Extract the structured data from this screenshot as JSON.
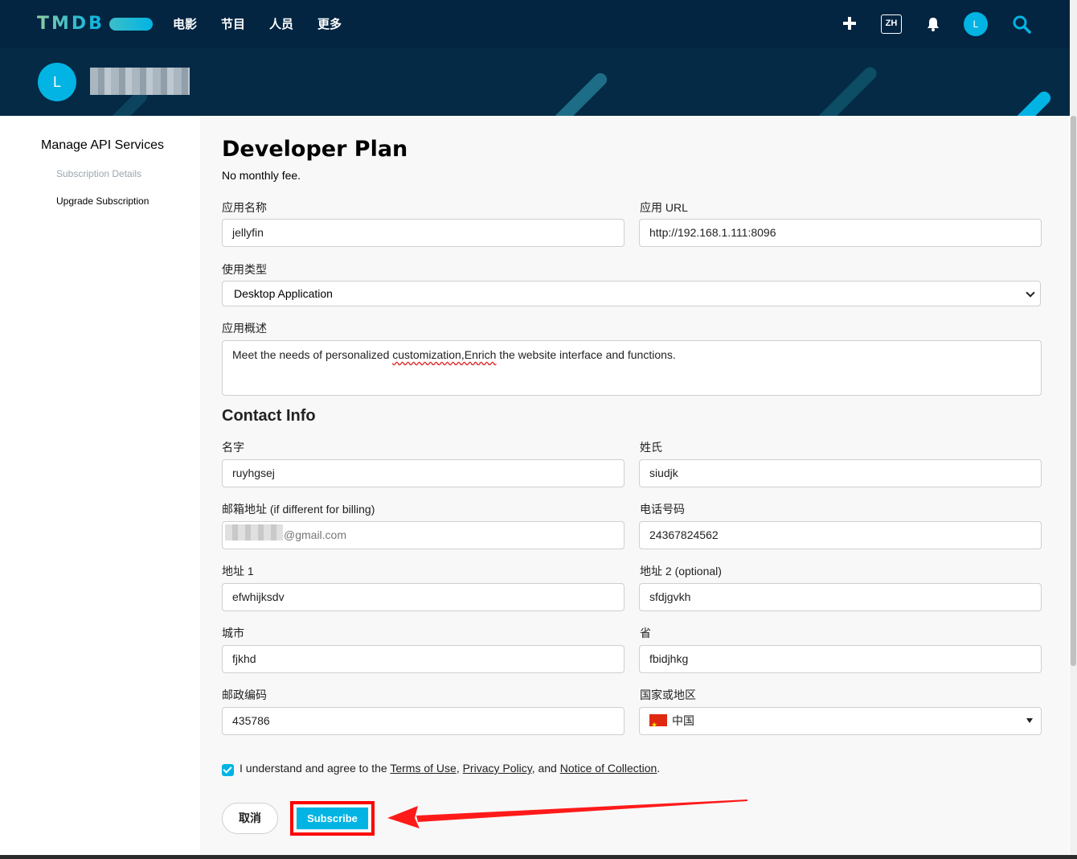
{
  "nav": {
    "logo": "TMDB",
    "links": [
      "电影",
      "节目",
      "人员",
      "更多"
    ],
    "lang": "ZH",
    "avatar_letter": "L"
  },
  "profile": {
    "avatar_letter": "L"
  },
  "sidebar": {
    "title": "Manage API Services",
    "items": [
      "Subscription Details",
      "Upgrade Subscription"
    ]
  },
  "form": {
    "title": "Developer Plan",
    "subtitle": "No monthly fee.",
    "app_name_label": "应用名称",
    "app_name_value": "jellyfin",
    "app_url_label": "应用 URL",
    "app_url_value": "http://192.168.1.111:8096",
    "usage_type_label": "使用类型",
    "usage_type_value": "Desktop Application",
    "summary_label": "应用概述",
    "summary_value_pre": "Meet the needs of personalized ",
    "summary_value_flag": "customization,Enrich",
    "summary_value_post": " the website interface and functions.",
    "contact_title": "Contact Info",
    "first_name_label": "名字",
    "first_name_value": "ruyhgsej",
    "last_name_label": "姓氏",
    "last_name_value": "siudjk",
    "email_label": "邮箱地址 (if different for billing)",
    "email_value": "@gmail.com",
    "phone_label": "电话号码",
    "phone_value": "24367824562",
    "address1_label": "地址 1",
    "address1_value": "efwhijksdv",
    "address2_label": "地址 2 (optional)",
    "address2_value": "sfdjgvkh",
    "city_label": "城市",
    "city_value": "fjkhd",
    "province_label": "省",
    "province_value": "fbidjhkg",
    "zip_label": "邮政编码",
    "zip_value": "435786",
    "country_label": "国家或地区",
    "country_value": "中国",
    "agree_pre": "I understand and agree to the ",
    "terms": "Terms of Use",
    "sep1": ", ",
    "privacy": "Privacy Policy",
    "sep2": ", and ",
    "notice": "Notice of Collection",
    "agree_post": ".",
    "cancel_label": "取消",
    "subscribe_label": "Subscribe"
  },
  "colors": {
    "nav_bg": "#032541",
    "accent": "#01b4e4",
    "highlight": "#ff0000"
  }
}
